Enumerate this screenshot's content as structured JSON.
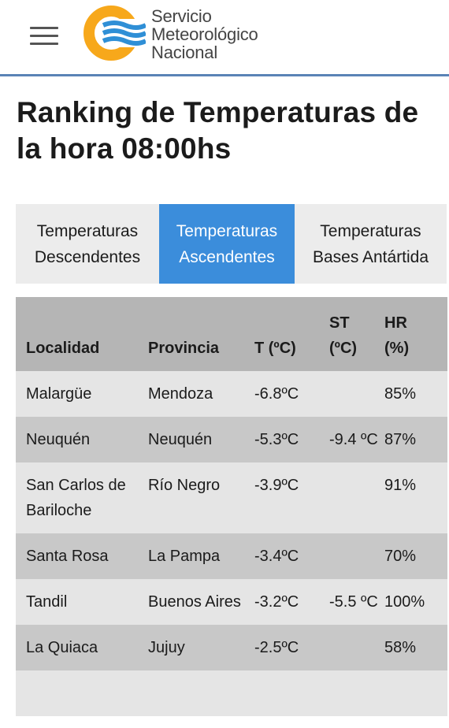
{
  "header": {
    "brand_lines": [
      "Servicio",
      "Meteorológico",
      "Nacional"
    ]
  },
  "page": {
    "title": "Ranking de Temperaturas de la hora 08:00hs"
  },
  "tabs": [
    {
      "label_line1": "Temperaturas",
      "label_line2": "Descendentes",
      "active": false
    },
    {
      "label_line1": "Temperaturas",
      "label_line2": "Ascendentes",
      "active": true
    },
    {
      "label_line1": "Temperaturas",
      "label_line2": "Bases Antártida",
      "active": false
    }
  ],
  "table": {
    "headers": {
      "localidad": "Localidad",
      "provincia": "Provincia",
      "t": "T (ºC)",
      "st_line1": "ST",
      "st_line2": "(ºC)",
      "hr_line1": "HR",
      "hr_line2": "(%)"
    },
    "rows": [
      {
        "localidad": "Malargüe",
        "provincia": "Mendoza",
        "t": "-6.8ºC",
        "st": "",
        "hr": "85%"
      },
      {
        "localidad": "Neuquén",
        "provincia": "Neuquén",
        "t": "-5.3ºC",
        "st": "-9.4 ºC",
        "hr": "87%"
      },
      {
        "localidad": "San Carlos de Bariloche",
        "provincia": "Río Negro",
        "t": "-3.9ºC",
        "st": "",
        "hr": "91%"
      },
      {
        "localidad": "Santa Rosa",
        "provincia": "La Pampa",
        "t": "-3.4ºC",
        "st": "",
        "hr": "70%"
      },
      {
        "localidad": "Tandil",
        "provincia": "Buenos Aires",
        "t": "-3.2ºC",
        "st": "-5.5 ºC",
        "hr": "100%"
      },
      {
        "localidad": "La Quiaca",
        "provincia": "Jujuy",
        "t": "-2.5ºC",
        "st": "",
        "hr": "58%"
      }
    ]
  },
  "colors": {
    "accent": "#3b8ddb",
    "header_rule": "#5a83b6",
    "logo_orange": "#f7a81b",
    "logo_blue": "#2f8fd6"
  },
  "icons": {
    "menu": "hamburger-menu-icon",
    "logo": "smn-logo-icon"
  }
}
